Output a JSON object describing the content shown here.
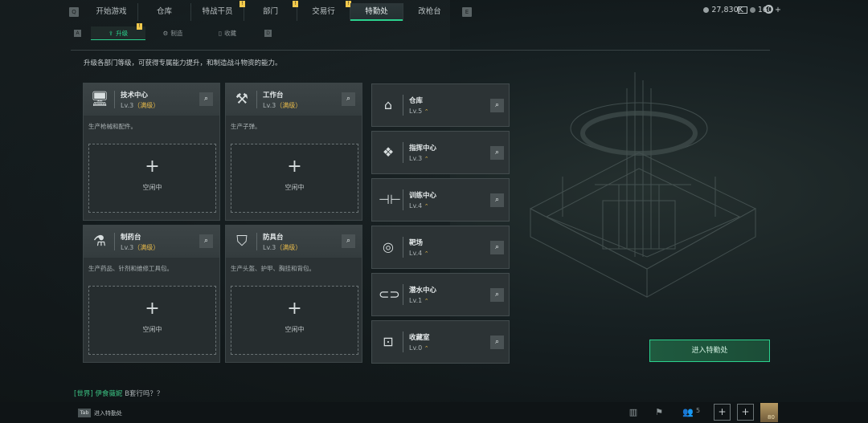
{
  "top_nav": {
    "left_key": "Q",
    "right_key": "E",
    "tabs": [
      {
        "label": "开始游戏",
        "badge": "",
        "active": false
      },
      {
        "label": "仓库",
        "badge": "",
        "active": false
      },
      {
        "label": "特战干员",
        "badge": "!",
        "active": false
      },
      {
        "label": "部门",
        "badge": "!",
        "active": false
      },
      {
        "label": "交易行",
        "badge": "!",
        "active": false
      },
      {
        "label": "特勤处",
        "badge": "",
        "active": true
      },
      {
        "label": "改枪台",
        "badge": "",
        "active": false
      }
    ]
  },
  "currency": {
    "coins": "27,830K",
    "tickets": "160 +"
  },
  "sub_nav": {
    "left_key": "A",
    "right_key": "D",
    "tabs": [
      {
        "label": "升级",
        "badge": "!",
        "active": true
      },
      {
        "label": "制造",
        "active": false
      },
      {
        "label": "收藏",
        "active": false
      }
    ]
  },
  "description": "升级各部门等级，可获得专属能力提升，和制造战斗物资的能力。",
  "workshops": [
    {
      "name": "技术中心",
      "level": "Lv.3",
      "max": "（满级）",
      "desc": "生产枪械和配件。",
      "slot": "空闲中",
      "icon": "monitor-icon"
    },
    {
      "name": "工作台",
      "level": "Lv.3",
      "max": "（满级）",
      "desc": "生产子弹。",
      "slot": "空闲中",
      "icon": "tools-icon"
    },
    {
      "name": "制药台",
      "level": "Lv.3",
      "max": "（满级）",
      "desc": "生产药品、针剂和维修工具包。",
      "slot": "空闲中",
      "icon": "microscope-icon"
    },
    {
      "name": "防具台",
      "level": "Lv.3",
      "max": "（满级）",
      "desc": "生产头盔、护甲、胸挂和背包。",
      "slot": "空闲中",
      "icon": "armor-icon"
    }
  ],
  "facilities": [
    {
      "name": "仓库",
      "level": "Lv.5",
      "icon": "warehouse-icon"
    },
    {
      "name": "指挥中心",
      "level": "Lv.3",
      "icon": "command-icon"
    },
    {
      "name": "训练中心",
      "level": "Lv.4",
      "icon": "dumbbell-icon"
    },
    {
      "name": "靶场",
      "level": "Lv.4",
      "icon": "target-icon"
    },
    {
      "name": "潜水中心",
      "level": "Lv.1",
      "icon": "goggles-icon"
    },
    {
      "name": "收藏室",
      "level": "Lv.0",
      "icon": "collection-icon"
    }
  ],
  "enter_button": "进入特勤处",
  "chat": {
    "channel": "[世界]",
    "user": "伊食薇妮",
    "message": "B套行吗？？"
  },
  "bottom": {
    "tab_key": "Tab",
    "tab_label": "进入特勤处",
    "friend_count": "5",
    "level": "80"
  },
  "colors": {
    "accent": "#2bd28e",
    "max_level": "#e6b94a",
    "badge": "#f2c94c"
  }
}
